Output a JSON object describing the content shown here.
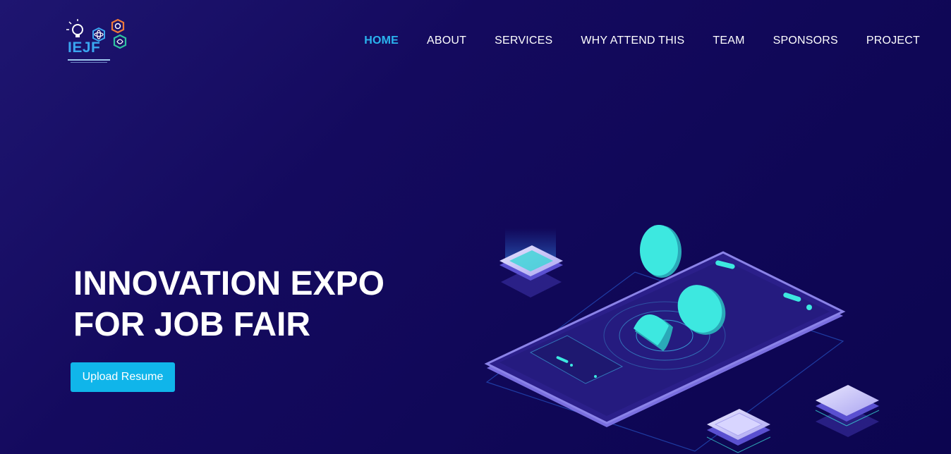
{
  "header": {
    "logo_text": "IEJF",
    "nav": [
      {
        "label": "HOME",
        "active": true
      },
      {
        "label": "ABOUT",
        "active": false
      },
      {
        "label": "SERVICES",
        "active": false
      },
      {
        "label": "WHY ATTEND THIS",
        "active": false
      },
      {
        "label": "TEAM",
        "active": false
      },
      {
        "label": "SPONSORS",
        "active": false
      },
      {
        "label": "PROJECT",
        "active": false
      }
    ]
  },
  "hero": {
    "title_line1": "INNOVATION EXPO",
    "title_line2": "FOR JOB FAIR",
    "cta_label": "Upload Resume"
  },
  "colors": {
    "background": "#140a5e",
    "accent": "#10b5ea",
    "nav_active": "#2ab4ef",
    "coin": "#3de8e0",
    "phone_edge": "#8b83e8"
  },
  "icons": [
    "lightbulb-icon",
    "atom-icon",
    "gear-icon",
    "brain-icon",
    "phone-illustration"
  ]
}
